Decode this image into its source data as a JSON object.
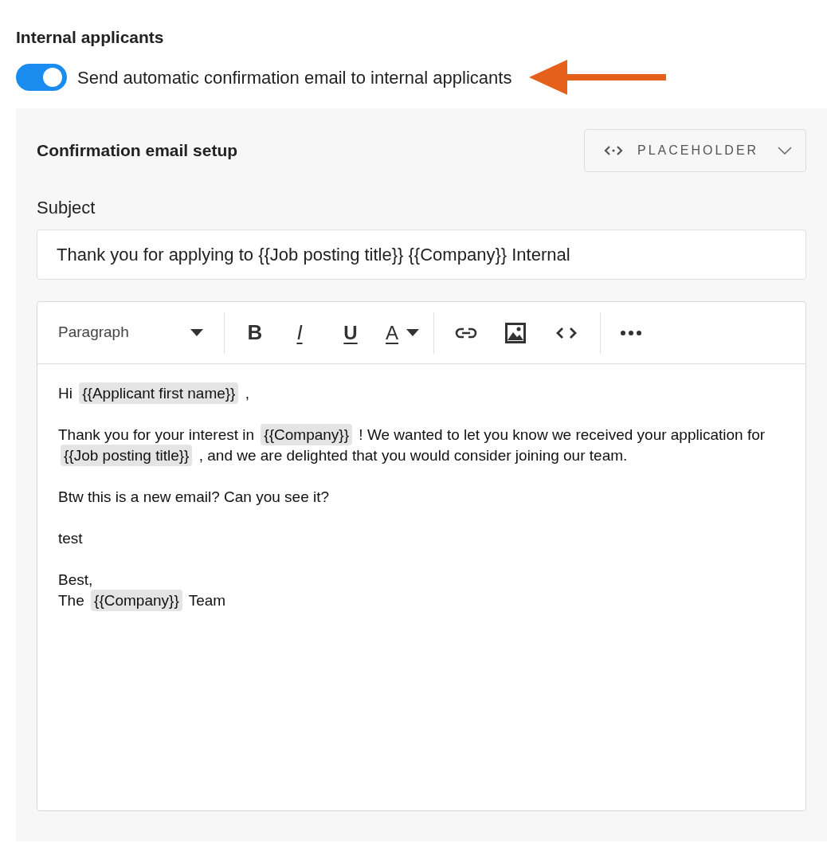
{
  "section_title": "Internal applicants",
  "auto_email_toggle": {
    "on": true,
    "label": "Send automatic confirmation email to internal applicants"
  },
  "setup_panel": {
    "title": "Confirmation email setup",
    "placeholder_button": "PLACEHOLDER",
    "subject_label": "Subject",
    "subject_value": "Thank you for applying to {{Job posting title}} {{Company}} Internal",
    "toolbar": {
      "block_style": "Paragraph",
      "bold": "B",
      "italic": "I",
      "underline": "U",
      "text_color": "A"
    },
    "body": [
      [
        {
          "kind": "text",
          "text": "Hi"
        },
        {
          "kind": "placeholder",
          "text": "{{Applicant first name}}"
        },
        {
          "kind": "text",
          "text": ","
        }
      ],
      [
        {
          "kind": "text",
          "text": "Thank you for your interest in"
        },
        {
          "kind": "placeholder",
          "text": "{{Company}}"
        },
        {
          "kind": "text",
          "text": "! We wanted to let you know we received your application for"
        },
        {
          "kind": "placeholder",
          "text": "{{Job posting title}}"
        },
        {
          "kind": "text",
          "text": ", and we are delighted that you would consider joining our team."
        }
      ],
      [
        {
          "kind": "text",
          "text": "Btw this is a new email? Can you see it?"
        }
      ],
      [
        {
          "kind": "text",
          "text": "test"
        }
      ],
      [
        {
          "kind": "text",
          "text": "Best,"
        },
        {
          "kind": "break"
        },
        {
          "kind": "text",
          "text": "The"
        },
        {
          "kind": "placeholder",
          "text": "{{Company}}"
        },
        {
          "kind": "text",
          "text": "Team"
        }
      ]
    ]
  }
}
